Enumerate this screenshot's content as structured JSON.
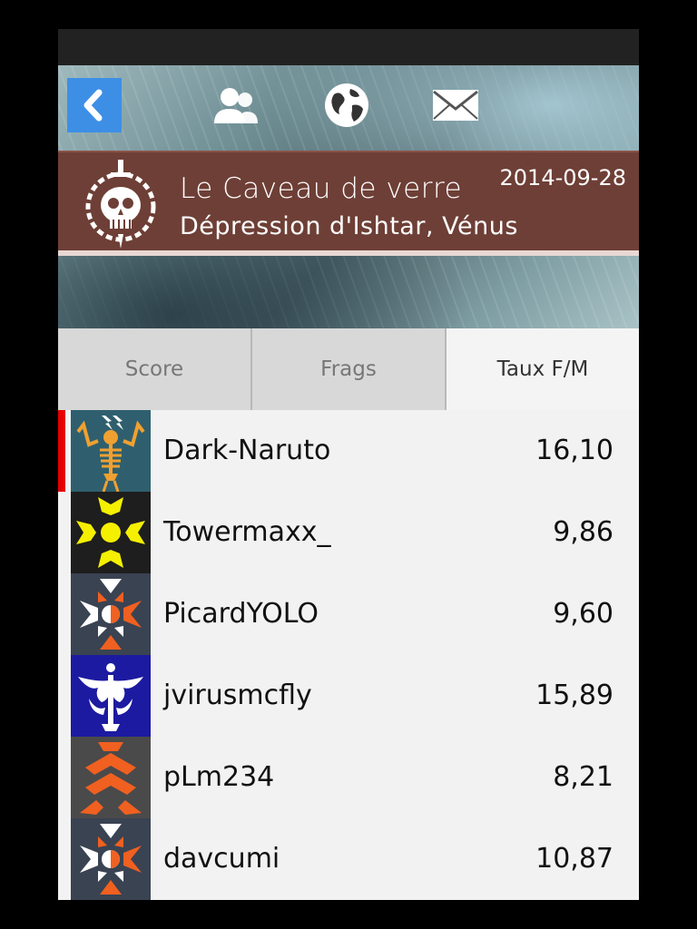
{
  "toolbar": {
    "back_icon": "chevron-left-icon",
    "friends_icon": "users-icon",
    "world_icon": "globe-icon",
    "messages_icon": "envelope-icon"
  },
  "match": {
    "map_name": "Le Caveau de verre",
    "location": "Dépression d'Ishtar, Vénus",
    "date": "2014-09-28",
    "emblem_icon": "skull-sword-emblem-icon"
  },
  "tabs": [
    {
      "label": "Score",
      "active": false
    },
    {
      "label": "Frags",
      "active": false
    },
    {
      "label": "Taux F/M",
      "active": true
    }
  ],
  "players": [
    {
      "name": "Dark-Naruto",
      "value": "16,10",
      "highlighted": true,
      "emblem": "skeleton-lightning-emblem",
      "emblem_bg": "#2f5f6e"
    },
    {
      "name": "Towermaxx_",
      "value": "9,86",
      "highlighted": false,
      "emblem": "yellow-sun-emblem",
      "emblem_bg": "#1e1e1e"
    },
    {
      "name": "PicardYOLO",
      "value": "9,60",
      "highlighted": false,
      "emblem": "orange-white-star-emblem",
      "emblem_bg": "#3a4352"
    },
    {
      "name": "jvirusmcfly",
      "value": "15,89",
      "highlighted": false,
      "emblem": "white-wings-emblem",
      "emblem_bg": "#1c1aa0"
    },
    {
      "name": "pLm234",
      "value": "8,21",
      "highlighted": false,
      "emblem": "orange-chevron-emblem",
      "emblem_bg": "#4a4a4a"
    },
    {
      "name": "davcumi",
      "value": "10,87",
      "highlighted": false,
      "emblem": "orange-white-star-emblem",
      "emblem_bg": "#3a4352"
    }
  ],
  "colors": {
    "accent_blue": "#3d8fe6",
    "banner": "#6e3f36",
    "highlight": "#e60000"
  }
}
